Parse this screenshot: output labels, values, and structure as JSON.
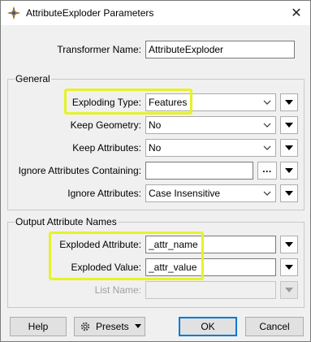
{
  "window": {
    "title": "AttributeExploder Parameters",
    "close_glyph": "✕"
  },
  "transformer": {
    "label": "Transformer Name:",
    "value": "AttributeExploder"
  },
  "general": {
    "title": "General",
    "exploding_type": {
      "label": "Exploding Type:",
      "value": "Features"
    },
    "keep_geometry": {
      "label": "Keep Geometry:",
      "value": "No"
    },
    "keep_attributes": {
      "label": "Keep Attributes:",
      "value": "No"
    },
    "ignore_containing": {
      "label": "Ignore Attributes Containing:",
      "value": "",
      "button": "..."
    },
    "ignore_attributes": {
      "label": "Ignore Attributes:",
      "value": "Case Insensitive"
    }
  },
  "output": {
    "title": "Output Attribute Names",
    "exploded_attribute": {
      "label": "Exploded Attribute:",
      "value": "_attr_name"
    },
    "exploded_value": {
      "label": "Exploded Value:",
      "value": "_attr_value"
    },
    "list_name": {
      "label": "List Name:",
      "value": ""
    }
  },
  "footer": {
    "help": "Help",
    "presets": "Presets",
    "ok": "OK",
    "cancel": "Cancel"
  },
  "colors": {
    "highlight": "#e6f228",
    "accent": "#0078d7"
  },
  "icons": [
    "transformer-icon",
    "close-icon",
    "chevron-down-icon",
    "dropdown-arrow-icon",
    "gear-icon"
  ]
}
